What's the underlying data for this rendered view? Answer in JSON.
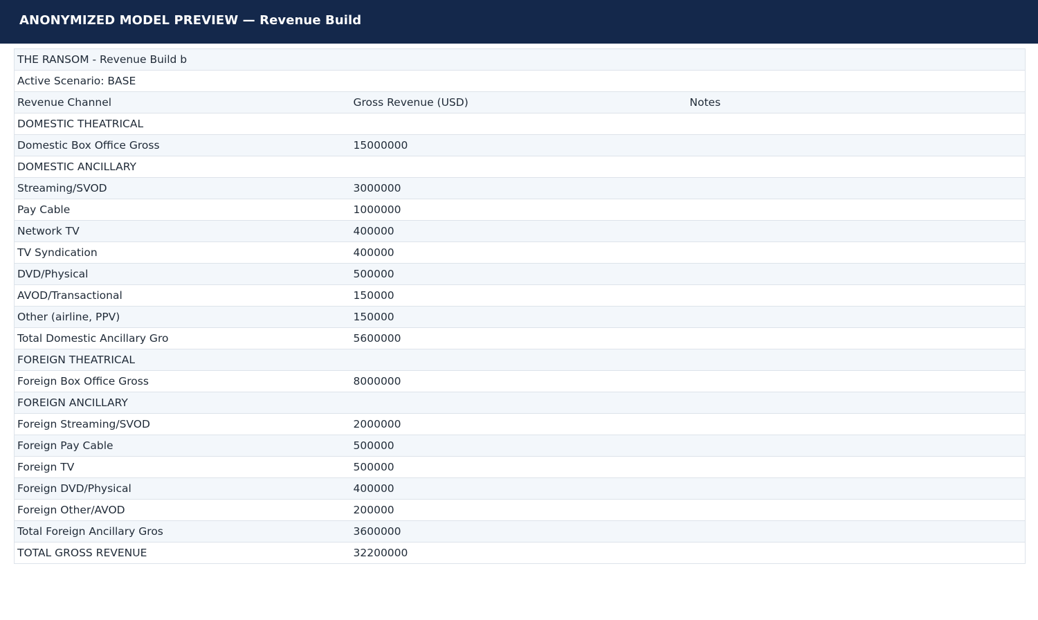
{
  "header": {
    "title": "ANONYMIZED MODEL PREVIEW — Revenue Build"
  },
  "sheet": {
    "title_row": "THE RANSOM - Revenue Build b",
    "scenario_row": "Active Scenario: BASE",
    "columns": [
      "Revenue Channel",
      "Gross Revenue (USD)",
      "Notes"
    ],
    "rows": [
      [
        "DOMESTIC THEATRICAL",
        "",
        ""
      ],
      [
        "Domestic Box Office Gross",
        "15000000",
        ""
      ],
      [
        "DOMESTIC ANCILLARY",
        "",
        ""
      ],
      [
        "Streaming/SVOD",
        "3000000",
        ""
      ],
      [
        "Pay Cable",
        "1000000",
        ""
      ],
      [
        "Network TV",
        "400000",
        ""
      ],
      [
        "TV Syndication",
        "400000",
        ""
      ],
      [
        "DVD/Physical",
        "500000",
        ""
      ],
      [
        "AVOD/Transactional",
        "150000",
        ""
      ],
      [
        "Other (airline, PPV)",
        "150000",
        ""
      ],
      [
        "Total Domestic Ancillary Gro",
        "5600000",
        ""
      ],
      [
        "FOREIGN THEATRICAL",
        "",
        ""
      ],
      [
        "Foreign Box Office Gross",
        "8000000",
        ""
      ],
      [
        "FOREIGN ANCILLARY",
        "",
        ""
      ],
      [
        "Foreign Streaming/SVOD",
        "2000000",
        ""
      ],
      [
        "Foreign Pay Cable",
        "500000",
        ""
      ],
      [
        "Foreign TV",
        "500000",
        ""
      ],
      [
        "Foreign DVD/Physical",
        "400000",
        ""
      ],
      [
        "Foreign Other/AVOD",
        "200000",
        ""
      ],
      [
        "Total Foreign Ancillary Gros",
        "3600000",
        ""
      ],
      [
        "TOTAL GROSS REVENUE",
        "32200000",
        ""
      ]
    ]
  }
}
